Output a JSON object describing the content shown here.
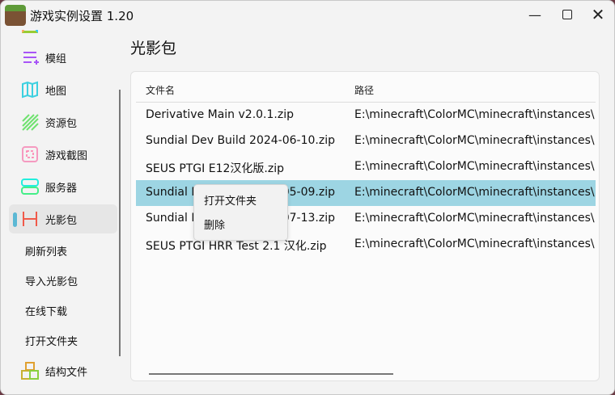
{
  "window": {
    "title": "游戏实例设置 1.20",
    "controls": [
      "minimize",
      "maximize",
      "close"
    ]
  },
  "sidebar": {
    "items": [
      {
        "label": "模组",
        "icon": "mod-icon"
      },
      {
        "label": "地图",
        "icon": "map-icon"
      },
      {
        "label": "资源包",
        "icon": "resourcepack-icon"
      },
      {
        "label": "游戏截图",
        "icon": "screenshot-icon"
      },
      {
        "label": "服务器",
        "icon": "server-icon"
      },
      {
        "label": "光影包",
        "icon": "shaderpack-icon",
        "selected": true
      }
    ],
    "actions": [
      "刷新列表",
      "导入光影包",
      "在线下载",
      "打开文件夹"
    ],
    "bottom": {
      "label": "结构文件",
      "icon": "structure-icon"
    }
  },
  "main": {
    "title": "光影包",
    "columns": [
      "文件名",
      "路径"
    ],
    "rows": [
      {
        "name": "Derivative Main v2.0.1.zip",
        "path": "E:\\minecraft\\ColorMC\\minecraft\\instances\\"
      },
      {
        "name": "Sundial Dev Build 2024-06-10.zip",
        "path": "E:\\minecraft\\ColorMC\\minecraft\\instances\\"
      },
      {
        "name": "SEUS PTGI E12汉化版.zip",
        "path": "E:\\minecraft\\ColorMC\\minecraft\\instances\\"
      },
      {
        "name": "Sundial Dev Build 2024-05-09.zip",
        "path": "E:\\minecraft\\ColorMC\\minecraft\\instances\\",
        "selected": true
      },
      {
        "name": "Sundial Dev Build 2024-07-13.zip",
        "path": "E:\\minecraft\\ColorMC\\minecraft\\instances\\"
      },
      {
        "name": "SEUS PTGI HRR Test 2.1 汉化.zip",
        "path": "E:\\minecraft\\ColorMC\\minecraft\\instances\\"
      }
    ]
  },
  "context_menu": {
    "items": [
      "打开文件夹",
      "删除"
    ]
  },
  "colors": {
    "selected_row": "#9dd5e3",
    "accent": "#5cb8d4"
  }
}
